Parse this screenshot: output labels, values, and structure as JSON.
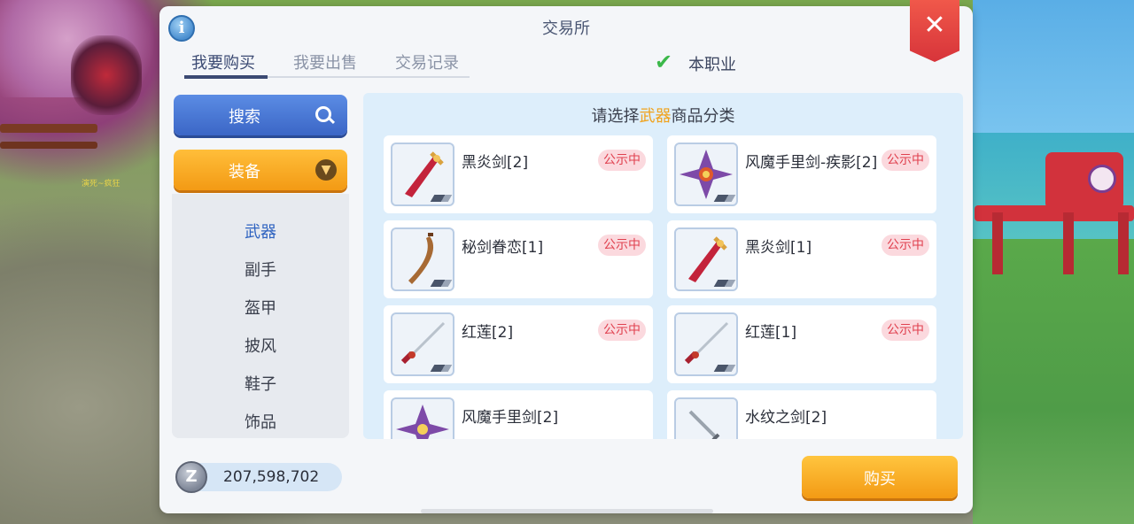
{
  "dialog": {
    "title": "交易所",
    "tabs": [
      {
        "label": "我要购买",
        "active": true
      },
      {
        "label": "我要出售",
        "active": false
      },
      {
        "label": "交易记录",
        "active": false
      }
    ],
    "job_filter": {
      "label": "本职业",
      "checked": true
    }
  },
  "left_panel": {
    "search_label": "搜索",
    "category_label": "装备",
    "categories": [
      {
        "label": "武器",
        "active": true
      },
      {
        "label": "副手",
        "active": false
      },
      {
        "label": "盔甲",
        "active": false
      },
      {
        "label": "披风",
        "active": false
      },
      {
        "label": "鞋子",
        "active": false
      },
      {
        "label": "饰品",
        "active": false
      }
    ]
  },
  "content": {
    "header_prefix": "请选择",
    "header_highlight": "武器",
    "header_suffix": "商品分类",
    "items": [
      {
        "name": "黑炎剑[2]",
        "status": "公示中",
        "icon": "red-sword-icon"
      },
      {
        "name": "风魔手里剑-疾影[2]",
        "status": "公示中",
        "icon": "shuriken-icon"
      },
      {
        "name": "秘剑眷恋[1]",
        "status": "公示中",
        "icon": "curved-blade-icon"
      },
      {
        "name": "黑炎剑[1]",
        "status": "公示中",
        "icon": "red-sword-icon"
      },
      {
        "name": "红莲[2]",
        "status": "公示中",
        "icon": "katana-icon"
      },
      {
        "name": "红莲[1]",
        "status": "公示中",
        "icon": "katana-icon"
      },
      {
        "name": "风魔手里剑[2]",
        "status": "",
        "icon": "shuriken-icon"
      },
      {
        "name": "水纹之剑[2]",
        "status": "",
        "icon": "silver-sword-icon"
      }
    ]
  },
  "footer": {
    "zeny_symbol": "Z",
    "zeny_amount": "207,598,702",
    "buy_label": "购买"
  },
  "game_world": {
    "npc_name": "演死~疯狂"
  }
}
